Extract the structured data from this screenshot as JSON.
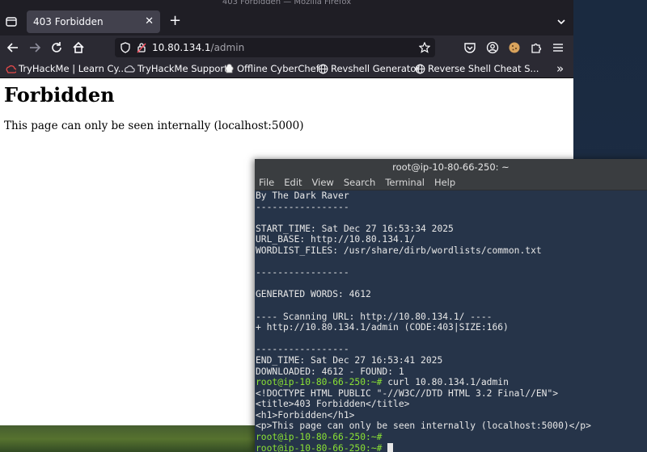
{
  "firefox": {
    "window_title": "403 Forbidden — Mozilla Firefox",
    "tab_title": "403 Forbidden",
    "tab_close": "✕",
    "new_tab": "+",
    "url_host": "10.80.134.1",
    "url_path": "/admin",
    "bookmarks": [
      {
        "label": "TryHackMe | Learn Cy...",
        "icon": "tryhackme-icon"
      },
      {
        "label": "TryHackMe Support",
        "icon": "cloud-icon"
      },
      {
        "label": "Offline CyberChef",
        "icon": "chef-hat-icon"
      },
      {
        "label": "Revshell Generator",
        "icon": "globe-icon"
      },
      {
        "label": "Reverse Shell Cheat S...",
        "icon": "globe-icon"
      }
    ],
    "bookmarks_more": "»"
  },
  "page": {
    "heading": "Forbidden",
    "message": "This page can only be seen internally (localhost:5000)"
  },
  "terminal": {
    "title": "root@ip-10-80-66-250: ~",
    "menu": [
      "File",
      "Edit",
      "View",
      "Search",
      "Terminal",
      "Help"
    ],
    "lines": [
      {
        "text": "By The Dark Raver"
      },
      {
        "text": "-----------------"
      },
      {
        "text": ""
      },
      {
        "text": "START_TIME: Sat Dec 27 16:53:34 2025"
      },
      {
        "text": "URL_BASE: http://10.80.134.1/"
      },
      {
        "text": "WORDLIST_FILES: /usr/share/dirb/wordlists/common.txt"
      },
      {
        "text": ""
      },
      {
        "text": "-----------------"
      },
      {
        "text": ""
      },
      {
        "text": "GENERATED WORDS: 4612"
      },
      {
        "text": ""
      },
      {
        "text": "---- Scanning URL: http://10.80.134.1/ ----"
      },
      {
        "text": "+ http://10.80.134.1/admin (CODE:403|SIZE:166)"
      },
      {
        "text": ""
      },
      {
        "text": "-----------------"
      },
      {
        "text": "END_TIME: Sat Dec 27 16:53:41 2025"
      },
      {
        "text": "DOWNLOADED: 4612 - FOUND: 1"
      },
      {
        "prompt": "root@ip-10-80-66-250:~#",
        "text": " curl 10.80.134.1/admin"
      },
      {
        "text": "<!DOCTYPE HTML PUBLIC \"-//W3C//DTD HTML 3.2 Final//EN\">"
      },
      {
        "text": "<title>403 Forbidden</title>"
      },
      {
        "text": "<h1>Forbidden</h1>"
      },
      {
        "text": "<p>This page can only be seen internally (localhost:5000)</p>"
      },
      {
        "prompt": "root@ip-10-80-66-250:~#",
        "text": ""
      },
      {
        "prompt": "root@ip-10-80-66-250:~#",
        "text": " ",
        "cursor": true
      }
    ]
  },
  "colors": {
    "prompt": "#8ae234",
    "terminal_bg": "#263449",
    "firefox_chrome": "#2b2a33"
  }
}
